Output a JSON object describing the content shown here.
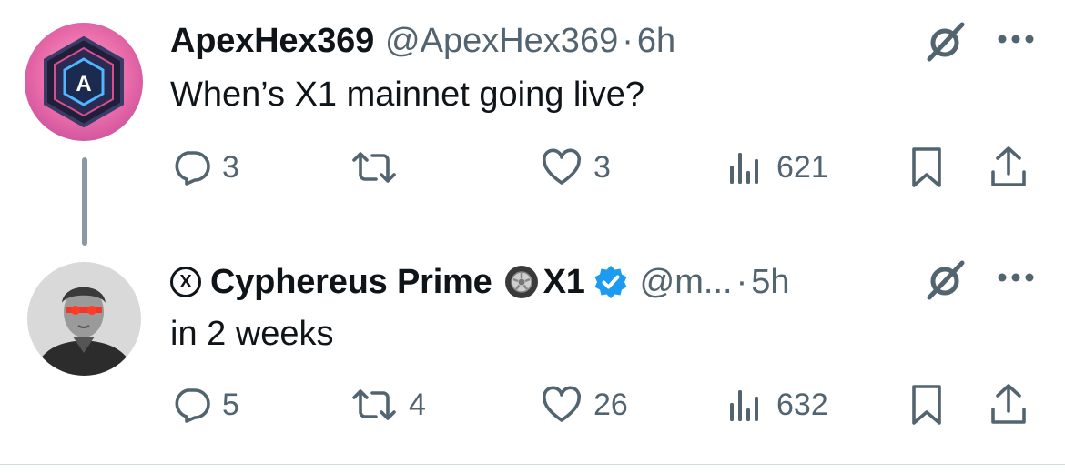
{
  "tweets": [
    {
      "name": "ApexHex369",
      "handle": "@ApexHex369",
      "separator": "·",
      "time": "6h",
      "text": "When’s X1 mainnet going live?",
      "avatar_letter": "A",
      "stats": {
        "replies": "3",
        "retweets": "",
        "likes": "3",
        "views": "621"
      }
    },
    {
      "name": "Cyphereus Prime",
      "name_suffix": "X1",
      "x_badge": "X",
      "handle": "@m...",
      "separator": "·",
      "time": "5h",
      "text": "in 2 weeks",
      "stats": {
        "replies": "5",
        "retweets": "4",
        "likes": "26",
        "views": "632"
      }
    }
  ],
  "colors": {
    "text": "#0f1419",
    "secondary": "#536471",
    "verified": "#1d9bf0",
    "thread_line": "#8b98a5",
    "avatar_bg": "#e86aa8"
  },
  "icons": [
    "reply-icon",
    "retweet-icon",
    "like-icon",
    "views-icon",
    "bookmark-icon",
    "share-icon",
    "grok-icon",
    "more-icon",
    "verified-icon",
    "x-badge-icon",
    "tire-emoji"
  ]
}
